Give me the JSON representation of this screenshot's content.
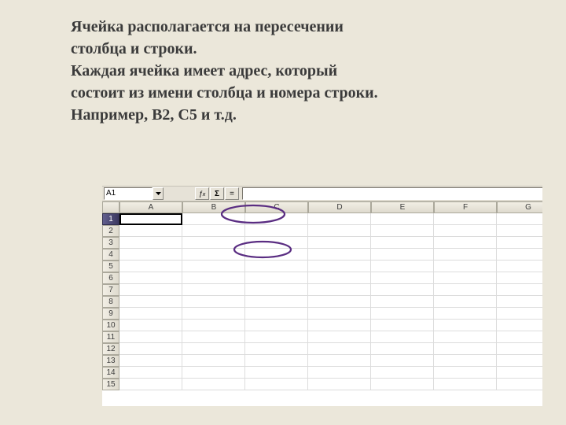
{
  "text": {
    "p1a": "Ячейка располагается на пересечении",
    "p1b": "столбца и строки.",
    "p2a": "Каждая ячейка имеет адрес, который",
    "p2b": "состоит из имени столбца и номера строки.",
    "p3": "Например, В2, С5 и т.д."
  },
  "spreadsheet": {
    "nameBox": "A1",
    "formula": "",
    "sigma": "Σ",
    "equals": "=",
    "columns": [
      "A",
      "B",
      "C",
      "D",
      "E",
      "F",
      "G"
    ],
    "rows": [
      "1",
      "2",
      "3",
      "4",
      "5",
      "6",
      "7",
      "8",
      "9",
      "10",
      "11",
      "12",
      "13",
      "14",
      "15"
    ],
    "activeCell": "A1"
  },
  "annotations": {
    "ellipse1": {
      "stroke": "#5a2d82"
    },
    "ellipse2": {
      "stroke": "#5a2d82"
    }
  }
}
